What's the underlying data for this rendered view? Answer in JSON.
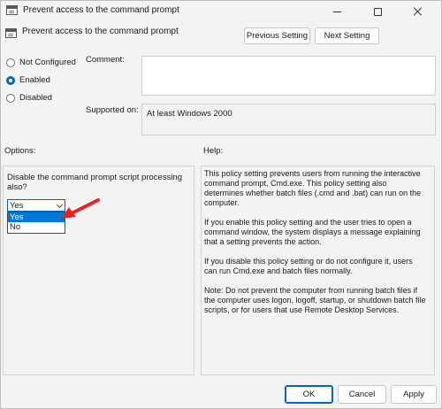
{
  "window": {
    "title": "Prevent access to the command prompt",
    "minimize_icon": "minimize-icon",
    "maximize_icon": "maximize-icon",
    "close_icon": "close-icon"
  },
  "header": {
    "policy_name": "Prevent access to the command prompt",
    "prev_label": "Previous Setting",
    "next_label": "Next Setting"
  },
  "state": {
    "options": [
      {
        "label": "Not Configured",
        "checked": false
      },
      {
        "label": "Enabled",
        "checked": true
      },
      {
        "label": "Disabled",
        "checked": false
      }
    ]
  },
  "comment": {
    "label": "Comment:",
    "value": ""
  },
  "supported": {
    "label": "Supported on:",
    "value": "At least Windows 2000"
  },
  "options_panel": {
    "label": "Options:",
    "question": "Disable the command prompt script processing also?",
    "selected": "Yes",
    "choices": [
      "Yes",
      "No"
    ],
    "highlight_color": "#0078d7",
    "arrow_color": "#e8212a"
  },
  "help_panel": {
    "label": "Help:",
    "paragraphs": [
      "This policy setting prevents users from running the interactive command prompt, Cmd.exe.  This policy setting also determines whether batch files (.cmd and .bat) can run on the computer.",
      "If you enable this policy setting and the user tries to open a command window, the system displays a message explaining that a setting prevents the action.",
      "If you disable this policy setting or do not configure it, users can run Cmd.exe and batch files normally.",
      "Note: Do not prevent the computer from running batch files if the computer uses logon, logoff, startup, or shutdown batch file scripts, or for users that use Remote Desktop Services."
    ]
  },
  "footer": {
    "ok_label": "OK",
    "cancel_label": "Cancel",
    "apply_label": "Apply"
  }
}
